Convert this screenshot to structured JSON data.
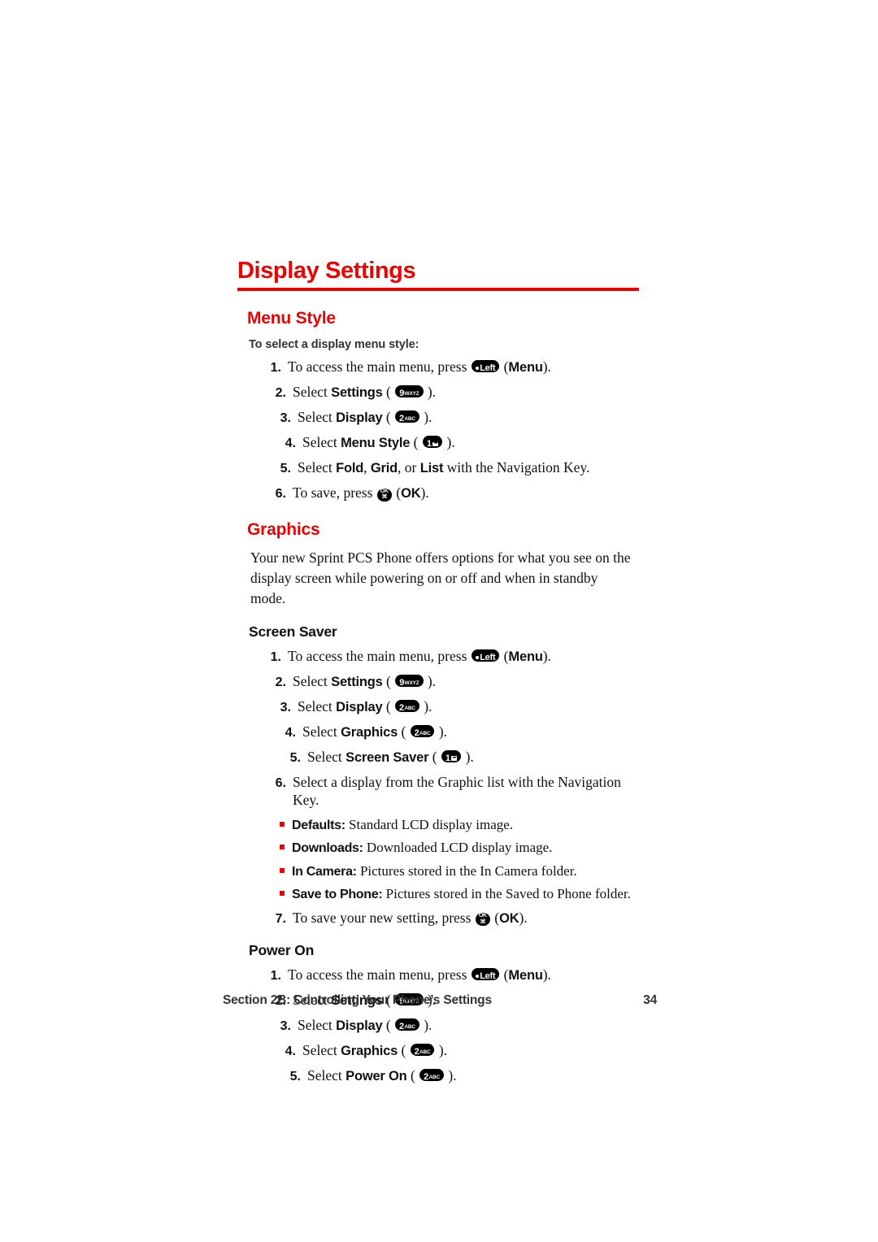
{
  "page": {
    "title": "Display Settings",
    "footer_section": "Section 2B: Controlling Your Phone’s Settings",
    "footer_page_number": "34",
    "accent_color": "#ee0000",
    "text_color": "#111111"
  },
  "keys": {
    "menu": {
      "name": "left-soft-key",
      "glyph": "dot",
      "main": "Left",
      "sub": ""
    },
    "nine": {
      "name": "key-9-wxyz",
      "glyph": "text",
      "main": "9",
      "sub": "WXYZ"
    },
    "two": {
      "name": "key-2-abc",
      "glyph": "text",
      "main": "2",
      "sub": "ABC"
    },
    "one": {
      "name": "key-1-voicemail",
      "glyph": "envelope",
      "main": "1",
      "sub": ""
    },
    "ok": {
      "name": "ok-key",
      "glyph": "ok",
      "top": "OK",
      "bottom": "⌘"
    }
  },
  "sections": [
    {
      "id": "menu-style",
      "heading": "Menu Style",
      "lead_in": "To select a display menu style:",
      "steps": [
        {
          "num": "1.",
          "indent": 0,
          "parts": [
            {
              "t": "text",
              "v": "To access the main menu, press "
            },
            {
              "t": "key",
              "v": "menu"
            },
            {
              "t": "text",
              "v": " ("
            },
            {
              "t": "bold",
              "v": "Menu"
            },
            {
              "t": "text",
              "v": ")."
            }
          ]
        },
        {
          "num": "2.",
          "indent": 1,
          "parts": [
            {
              "t": "text",
              "v": "Select "
            },
            {
              "t": "bold",
              "v": "Settings"
            },
            {
              "t": "text",
              "v": " ( "
            },
            {
              "t": "key",
              "v": "nine"
            },
            {
              "t": "text",
              "v": " )."
            }
          ]
        },
        {
          "num": "3.",
          "indent": 2,
          "parts": [
            {
              "t": "text",
              "v": "Select "
            },
            {
              "t": "bold",
              "v": "Display"
            },
            {
              "t": "text",
              "v": " ( "
            },
            {
              "t": "key",
              "v": "two"
            },
            {
              "t": "text",
              "v": " )."
            }
          ]
        },
        {
          "num": "4.",
          "indent": 3,
          "parts": [
            {
              "t": "text",
              "v": "Select "
            },
            {
              "t": "bold",
              "v": "Menu Style"
            },
            {
              "t": "text",
              "v": " ( "
            },
            {
              "t": "key",
              "v": "one"
            },
            {
              "t": "text",
              "v": " )."
            }
          ]
        },
        {
          "num": "5.",
          "indent": 2,
          "parts": [
            {
              "t": "text",
              "v": "Select "
            },
            {
              "t": "bold",
              "v": "Fold"
            },
            {
              "t": "text",
              "v": ", "
            },
            {
              "t": "bold",
              "v": "Grid"
            },
            {
              "t": "text",
              "v": ", or "
            },
            {
              "t": "bold",
              "v": "List"
            },
            {
              "t": "text",
              "v": " with the Navigation Key."
            }
          ]
        },
        {
          "num": "6.",
          "indent": 1,
          "parts": [
            {
              "t": "text",
              "v": "To save, press "
            },
            {
              "t": "key",
              "v": "ok"
            },
            {
              "t": "text",
              "v": " ("
            },
            {
              "t": "bold",
              "v": "OK"
            },
            {
              "t": "text",
              "v": ")."
            }
          ]
        }
      ]
    },
    {
      "id": "graphics",
      "heading": "Graphics",
      "paragraph": "Your new Sprint PCS Phone offers options for what you see on the display screen while powering on or off and when in standby mode.",
      "subsections": [
        {
          "id": "screen-saver",
          "heading": "Screen Saver",
          "steps": [
            {
              "num": "1.",
              "indent": 0,
              "parts": [
                {
                  "t": "text",
                  "v": "To access the main menu, press "
                },
                {
                  "t": "key",
                  "v": "menu"
                },
                {
                  "t": "text",
                  "v": " ("
                },
                {
                  "t": "bold",
                  "v": "Menu"
                },
                {
                  "t": "text",
                  "v": ")."
                }
              ]
            },
            {
              "num": "2.",
              "indent": 1,
              "parts": [
                {
                  "t": "text",
                  "v": "Select "
                },
                {
                  "t": "bold",
                  "v": "Settings"
                },
                {
                  "t": "text",
                  "v": " ( "
                },
                {
                  "t": "key",
                  "v": "nine"
                },
                {
                  "t": "text",
                  "v": " )."
                }
              ]
            },
            {
              "num": "3.",
              "indent": 2,
              "parts": [
                {
                  "t": "text",
                  "v": "Select "
                },
                {
                  "t": "bold",
                  "v": "Display"
                },
                {
                  "t": "text",
                  "v": " ( "
                },
                {
                  "t": "key",
                  "v": "two"
                },
                {
                  "t": "text",
                  "v": " )."
                }
              ]
            },
            {
              "num": "4.",
              "indent": 3,
              "parts": [
                {
                  "t": "text",
                  "v": "Select "
                },
                {
                  "t": "bold",
                  "v": "Graphics"
                },
                {
                  "t": "text",
                  "v": " ( "
                },
                {
                  "t": "key",
                  "v": "two"
                },
                {
                  "t": "text",
                  "v": " )."
                }
              ]
            },
            {
              "num": "5.",
              "indent": 4,
              "parts": [
                {
                  "t": "text",
                  "v": "Select "
                },
                {
                  "t": "bold",
                  "v": "Screen Saver"
                },
                {
                  "t": "text",
                  "v": " ( "
                },
                {
                  "t": "key",
                  "v": "one"
                },
                {
                  "t": "text",
                  "v": " )."
                }
              ]
            },
            {
              "num": "6.",
              "indent": 1,
              "parts": [
                {
                  "t": "text",
                  "v": "Select a display from the Graphic list with the Navigation Key."
                }
              ]
            }
          ],
          "bullets": [
            {
              "label": "Defaults:",
              "text": " Standard LCD display image."
            },
            {
              "label": "Downloads:",
              "text": " Downloaded LCD display image."
            },
            {
              "label": "In Camera:",
              "text": " Pictures stored in the In Camera folder."
            },
            {
              "label": "Save to Phone:",
              "text": " Pictures stored in the Saved to Phone folder."
            }
          ],
          "steps_after": [
            {
              "num": "7.",
              "indent": 1,
              "parts": [
                {
                  "t": "text",
                  "v": "To save your new setting, press "
                },
                {
                  "t": "key",
                  "v": "ok"
                },
                {
                  "t": "text",
                  "v": " ("
                },
                {
                  "t": "bold",
                  "v": "OK"
                },
                {
                  "t": "text",
                  "v": ")."
                }
              ]
            }
          ]
        },
        {
          "id": "power-on",
          "heading": "Power On",
          "steps": [
            {
              "num": "1.",
              "indent": 0,
              "parts": [
                {
                  "t": "text",
                  "v": "To access the main menu, press "
                },
                {
                  "t": "key",
                  "v": "menu"
                },
                {
                  "t": "text",
                  "v": " ("
                },
                {
                  "t": "bold",
                  "v": "Menu"
                },
                {
                  "t": "text",
                  "v": ")."
                }
              ]
            },
            {
              "num": "2.",
              "indent": 1,
              "parts": [
                {
                  "t": "text",
                  "v": "Select "
                },
                {
                  "t": "bold",
                  "v": "Settings"
                },
                {
                  "t": "text",
                  "v": " ( "
                },
                {
                  "t": "key",
                  "v": "nine"
                },
                {
                  "t": "text",
                  "v": " )."
                }
              ]
            },
            {
              "num": "3.",
              "indent": 2,
              "parts": [
                {
                  "t": "text",
                  "v": "Select "
                },
                {
                  "t": "bold",
                  "v": "Display"
                },
                {
                  "t": "text",
                  "v": " ( "
                },
                {
                  "t": "key",
                  "v": "two"
                },
                {
                  "t": "text",
                  "v": " )."
                }
              ]
            },
            {
              "num": "4.",
              "indent": 3,
              "parts": [
                {
                  "t": "text",
                  "v": "Select "
                },
                {
                  "t": "bold",
                  "v": "Graphics"
                },
                {
                  "t": "text",
                  "v": " ( "
                },
                {
                  "t": "key",
                  "v": "two"
                },
                {
                  "t": "text",
                  "v": " )."
                }
              ]
            },
            {
              "num": "5.",
              "indent": 4,
              "parts": [
                {
                  "t": "text",
                  "v": "Select "
                },
                {
                  "t": "bold",
                  "v": "Power On"
                },
                {
                  "t": "text",
                  "v": " ( "
                },
                {
                  "t": "key",
                  "v": "two"
                },
                {
                  "t": "text",
                  "v": " )."
                }
              ]
            }
          ]
        }
      ]
    }
  ]
}
